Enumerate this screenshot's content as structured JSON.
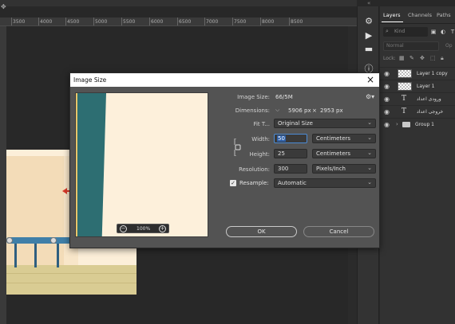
{
  "ruler": {
    "ticks": [
      "3500",
      "4000",
      "4500",
      "5000",
      "5500",
      "6000",
      "6500",
      "7000",
      "7500",
      "8000",
      "8500"
    ]
  },
  "tools": {
    "icons": [
      "adjust-icon",
      "play-icon",
      "comment-icon",
      "info-icon",
      "properties-icon",
      "grid-icon",
      "paragraph-icon",
      "layers-icon"
    ]
  },
  "panel": {
    "tabs": [
      "Layers",
      "Channels",
      "Paths"
    ],
    "search_placeholder": "Kind",
    "blend_mode": "Normal",
    "opacity_label": "Op",
    "lock_label": "Lock:",
    "layers": [
      {
        "name": "Layer 1 copy",
        "type": "raster"
      },
      {
        "name": "Layer 1",
        "type": "raster"
      },
      {
        "name": "ورودی اعداد",
        "type": "text"
      },
      {
        "name": "خروجی اعداد",
        "type": "text"
      },
      {
        "name": "Group 1",
        "type": "group"
      }
    ]
  },
  "dialog": {
    "title": "Image Size",
    "close": "×",
    "image_size_label": "Image Size:",
    "image_size_value": "66/5M",
    "dimensions_label": "Dimensions:",
    "dim_width": "5906 px",
    "dim_x": "×",
    "dim_height": "2953 px",
    "fit_label": "Fit T...",
    "fit_value": "Original Size",
    "width_label": "Width:",
    "width_value": "50",
    "width_unit": "Centimeters",
    "height_label": "Height:",
    "height_value": "25",
    "height_unit": "Centimeters",
    "resolution_label": "Resolution:",
    "resolution_value": "300",
    "resolution_unit": "Pixels/Inch",
    "resample_label": "Resample:",
    "resample_checked": true,
    "resample_value": "Automatic",
    "zoom_value": "100%",
    "ok_label": "OK",
    "cancel_label": "Cancel"
  },
  "colors": {
    "accent": "#4b8bd6",
    "preview_teal": "#2d6e72",
    "preview_cream": "#fdf0db",
    "arrow_red": "#d93a2b"
  }
}
